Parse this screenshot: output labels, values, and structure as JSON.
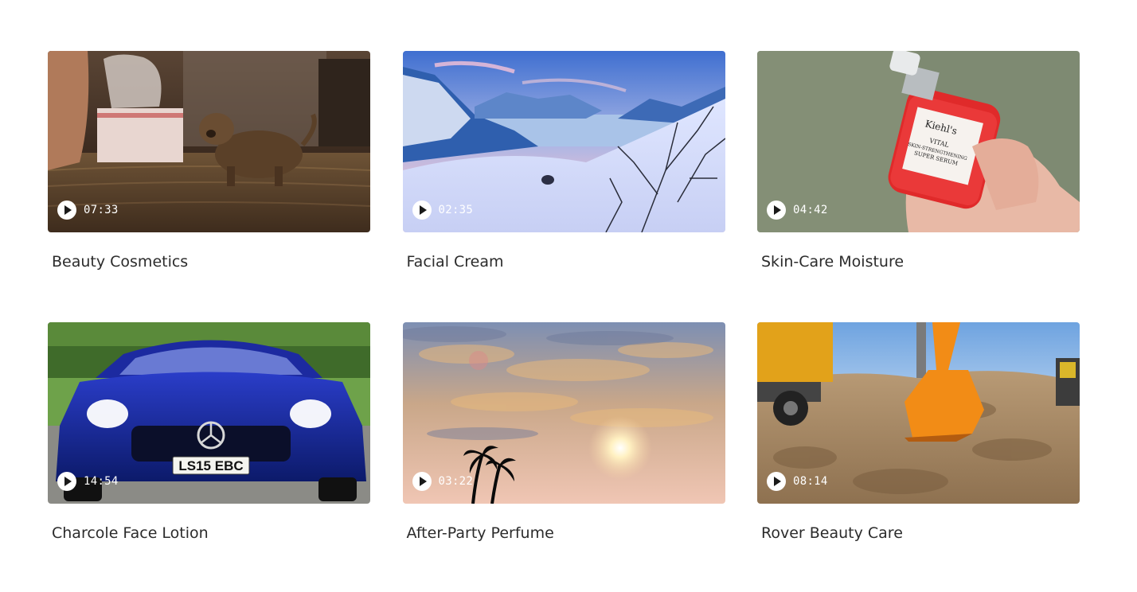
{
  "videos": [
    {
      "title": "Beauty Cosmetics",
      "duration": "07:33",
      "thumbnail": "puppy-on-rug"
    },
    {
      "title": "Facial Cream",
      "duration": "02:35",
      "thumbnail": "snowy-fjord"
    },
    {
      "title": "Skin-Care Moisture",
      "duration": "04:42",
      "thumbnail": "hand-holding-serum-bottle"
    },
    {
      "title": "Charcole Face Lotion",
      "duration": "14:54",
      "thumbnail": "blue-sports-car"
    },
    {
      "title": "After-Party Perfume",
      "duration": "03:22",
      "thumbnail": "sunset-sky-with-palms"
    },
    {
      "title": "Rover Beauty Care",
      "duration": "08:14",
      "thumbnail": "excavator-digging"
    }
  ],
  "images": {
    "serum_label_brand": "Kiehl's",
    "serum_label_line1": "VITAL",
    "serum_label_line2": "SKIN-STRENGTHENING",
    "serum_label_line3": "SUPER SERUM",
    "car_plate": "LS15 EBC"
  },
  "colors": {
    "title_text": "#2b2b2b",
    "overlay_text": "#ffffff",
    "page_background": "#ffffff"
  }
}
